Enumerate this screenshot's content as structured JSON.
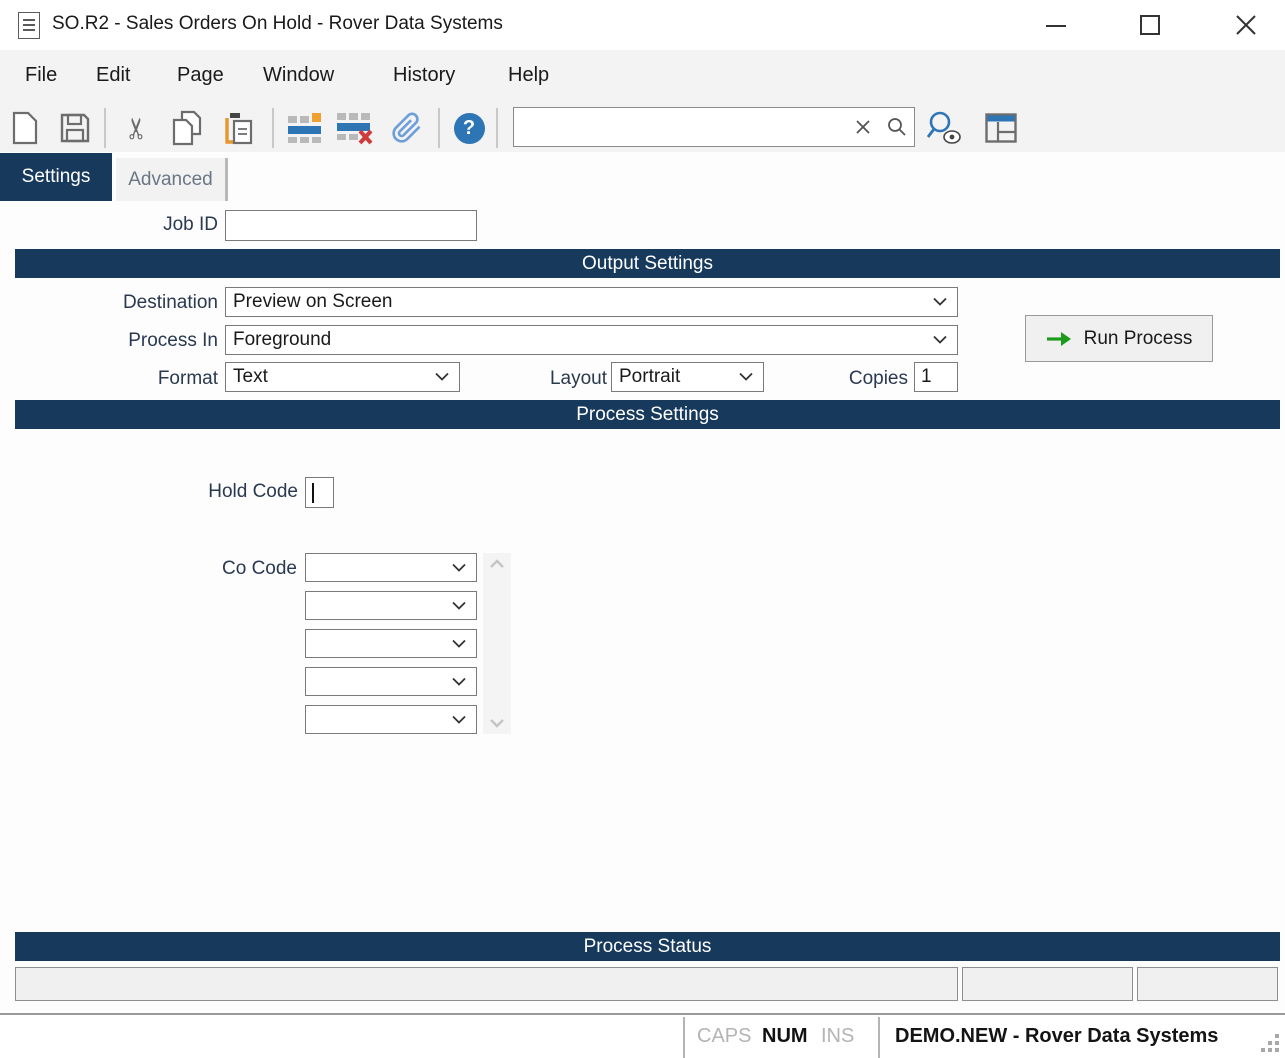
{
  "window": {
    "title": "SO.R2 - Sales Orders On Hold - Rover Data Systems"
  },
  "menu": {
    "items": [
      "File",
      "Edit",
      "Page",
      "Window",
      "History",
      "Help"
    ]
  },
  "toolbar": {
    "search_value": "",
    "help_glyph": "?"
  },
  "tabs": {
    "settings": "Settings",
    "advanced": "Advanced"
  },
  "form": {
    "job_id_label": "Job ID",
    "job_id_value": "",
    "output": {
      "header": "Output Settings",
      "destination_label": "Destination",
      "destination_value": "Preview on Screen",
      "process_in_label": "Process In",
      "process_in_value": "Foreground",
      "format_label": "Format",
      "format_value": "Text",
      "layout_label": "Layout",
      "layout_value": "Portrait",
      "copies_label": "Copies",
      "copies_value": "1",
      "run_button_label": "Run Process"
    },
    "process": {
      "header": "Process Settings",
      "hold_code_label": "Hold Code",
      "hold_code_value": "",
      "co_code_label": "Co Code",
      "co_code_values": [
        "",
        "",
        "",
        "",
        ""
      ]
    },
    "status_section": {
      "header": "Process Status",
      "fields": [
        "",
        "",
        ""
      ]
    }
  },
  "statusbar": {
    "caps": "CAPS",
    "num": "NUM",
    "ins": "INS",
    "session": "DEMO.NEW - Rover Data Systems"
  },
  "colors": {
    "header_navy": "#17395c",
    "accent_blue": "#2e75b6",
    "run_green": "#1d9b1d",
    "paste_orange": "#e8952f",
    "delete_red": "#cf3a3a",
    "icon_gray": "#6d6d6d"
  }
}
